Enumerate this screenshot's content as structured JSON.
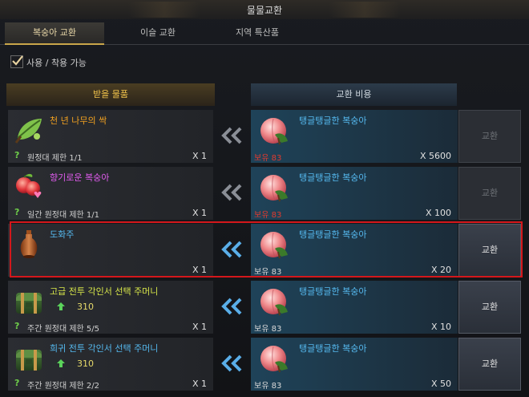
{
  "window": {
    "title": "물물교환"
  },
  "tabs": [
    {
      "label": "복숭아 교환",
      "active": true
    },
    {
      "label": "이슬 교환",
      "active": false
    },
    {
      "label": "지역 특산품",
      "active": false
    }
  ],
  "filter": {
    "label": "사용 / 착용 가능",
    "checked": true
  },
  "headers": {
    "receive": "받을 물품",
    "cost": "교환 비용"
  },
  "colors": {
    "gold": "#f0c24b",
    "pink": "#e25cf0",
    "blue": "#55b9ef",
    "green": "#d9e84a",
    "red": "#e23a2e",
    "highlight": "#d4171b"
  },
  "rows": [
    {
      "item": {
        "name": "천 년 나무의 싹",
        "name_color": "#f0a020",
        "icon": "leaf-sprout-icon",
        "points": "",
        "limit": "원정대 제한 1/1",
        "qty": "X 1"
      },
      "cost": {
        "name": "탱글탱글한 복숭아",
        "icon": "peach-icon",
        "owned": "보유 83",
        "owned_short": true,
        "qty": "X 5600"
      },
      "button": {
        "label": "교환",
        "enabled": false
      }
    },
    {
      "item": {
        "name": "향기로운 복숭아",
        "name_color": "#e25cf0",
        "icon": "fragrant-peach-icon",
        "points": "",
        "limit": "일간 원정대 제한 1/1",
        "qty": "X 1"
      },
      "cost": {
        "name": "탱글탱글한 복숭아",
        "icon": "peach-icon",
        "owned": "보유 83",
        "owned_short": true,
        "qty": "X 100"
      },
      "button": {
        "label": "교환",
        "enabled": false
      }
    },
    {
      "item": {
        "name": "도화주",
        "name_color": "#55b9ef",
        "icon": "wine-bottle-icon",
        "points": "",
        "limit": "",
        "qty": "X 1"
      },
      "cost": {
        "name": "탱글탱글한 복숭아",
        "icon": "peach-icon",
        "owned": "보유 83",
        "owned_short": false,
        "qty": "X 20"
      },
      "button": {
        "label": "교환",
        "enabled": true
      },
      "selected": true
    },
    {
      "item": {
        "name": "고급 전투 각인서 선택 주머니",
        "name_color": "#d9e84a",
        "icon": "bag-icon",
        "points": "310",
        "limit": "주간 원정대 제한 5/5",
        "qty": "X 1"
      },
      "cost": {
        "name": "탱글탱글한 복숭아",
        "icon": "peach-icon",
        "owned": "보유 83",
        "owned_short": false,
        "qty": "X 10"
      },
      "button": {
        "label": "교환",
        "enabled": true
      }
    },
    {
      "item": {
        "name": "희귀 전투 각인서 선택 주머니",
        "name_color": "#55b9ef",
        "icon": "bag-icon",
        "points": "310",
        "limit": "주간 원정대 제한 2/2",
        "qty": "X 1"
      },
      "cost": {
        "name": "탱글탱글한 복숭아",
        "icon": "peach-icon",
        "owned": "보유 83",
        "owned_short": false,
        "qty": "X 50"
      },
      "button": {
        "label": "교환",
        "enabled": true
      }
    }
  ]
}
